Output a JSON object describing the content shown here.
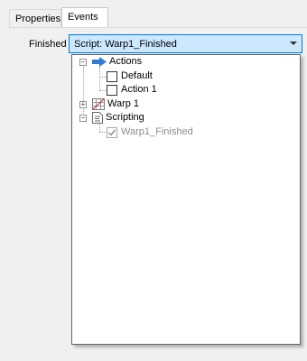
{
  "tabs": [
    {
      "label": "Properties",
      "active": false
    },
    {
      "label": "Events",
      "active": true
    }
  ],
  "field": {
    "label": "Finished",
    "value": "Script: Warp1_Finished"
  },
  "tree": {
    "actions": {
      "label": "Actions",
      "icon": "arrow-right-icon",
      "expanded": true
    },
    "default": {
      "label": "Default",
      "checked": false
    },
    "action1": {
      "label": "Action 1",
      "checked": false
    },
    "warp1": {
      "label": "Warp 1",
      "icon": "warp-grid-icon",
      "expanded": false
    },
    "scripting": {
      "label": "Scripting",
      "icon": "script-icon",
      "expanded": true
    },
    "warp1_finished": {
      "label": "Warp1_Finished",
      "checked": true
    }
  },
  "colors": {
    "accent": "#0078d7",
    "combo_bg": "#cce8ff",
    "arrow_icon": "#2f7bd5"
  }
}
